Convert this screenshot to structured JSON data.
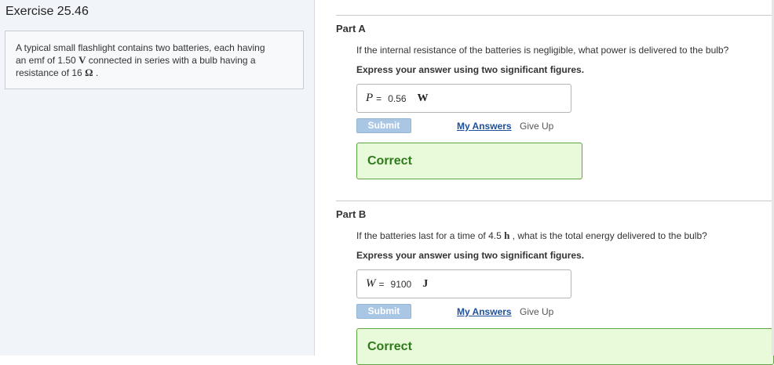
{
  "exercise": {
    "title": "Exercise 25.46",
    "problem": {
      "line1": "A typical small flashlight contains two batteries, each having",
      "line2_pre": "an emf of 1.50 ",
      "line2_sym": "V",
      "line2_post": " connected in series with a bulb having a",
      "line3_pre": "resistance of 16 ",
      "line3_sym": "Ω",
      "line3_post": " ."
    }
  },
  "parts": [
    {
      "title": "Part A",
      "question_pre": "If the internal resistance of the batteries is negligible, what power is delivered to the bulb?",
      "question_sym": "",
      "question_post": "",
      "instruction": "Express your answer using two significant figures.",
      "answer": {
        "variable": "P",
        "equals": "=",
        "value": "0.56",
        "unit": "W"
      },
      "submit_label": "Submit",
      "my_answers_label": "My Answers",
      "give_up_label": "Give Up",
      "feedback": "Correct"
    },
    {
      "title": "Part B",
      "question_pre": "If the batteries last for a time of 4.5 ",
      "question_sym": "h",
      "question_post": " , what is the total energy delivered to the bulb?",
      "instruction": "Express your answer using two significant figures.",
      "answer": {
        "variable": "W",
        "equals": "=",
        "value": "9100",
        "unit": "J"
      },
      "submit_label": "Submit",
      "my_answers_label": "My Answers",
      "give_up_label": "Give Up",
      "feedback": "Correct"
    }
  ],
  "colors": {
    "correct_bg": "#e8fad9",
    "correct_border": "#5fa642",
    "correct_text": "#2f7a1c",
    "submit_bg": "#a9c6e4",
    "link": "#1d4f99"
  }
}
